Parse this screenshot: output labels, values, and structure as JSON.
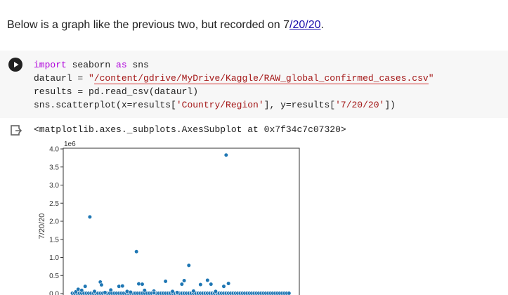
{
  "markdown": {
    "prefix": "Below is a graph like the previous two, but recorded on 7",
    "link": "/20/20",
    "suffix": "."
  },
  "code": {
    "line1": {
      "kw1": "import",
      "mod": " seaborn ",
      "kw2": "as",
      "alias": " sns"
    },
    "line2": {
      "lhs": "dataurl = ",
      "q1": "\"",
      "path": "/content/gdrive/MyDrive/Kaggle/RAW_global_confirmed_cases.csv",
      "q2": "\""
    },
    "line3": "results = pd.read_csv(dataurl)",
    "line4": {
      "a": "sns.scatterplot(x=results[",
      "s1": "'Country/Region'",
      "b": "], y=results[",
      "s2": "'7/20/20'",
      "c": "])"
    }
  },
  "output": {
    "repr": "<matplotlib.axes._subplots.AxesSubplot at 0x7f34c7c07320>"
  },
  "chart_data": {
    "type": "scatter",
    "ylabel": "7/20/20",
    "xlabel": "",
    "y_multiplier": "1e6",
    "ylim": [
      0,
      4.0
    ],
    "yticks": [
      "0.0",
      "0.5",
      "1.0",
      "1.5",
      "2.0",
      "2.5",
      "3.0",
      "3.5",
      "4.0"
    ],
    "grid": false,
    "x_count": 188,
    "points": [
      [
        3,
        0.05
      ],
      [
        5,
        0.12
      ],
      [
        8,
        0.09
      ],
      [
        11,
        0.2
      ],
      [
        15,
        2.12
      ],
      [
        19,
        0.06
      ],
      [
        24,
        0.32
      ],
      [
        25,
        0.24
      ],
      [
        28,
        0.03
      ],
      [
        33,
        0.1
      ],
      [
        40,
        0.2
      ],
      [
        43,
        0.21
      ],
      [
        47,
        0.06
      ],
      [
        55,
        1.16
      ],
      [
        57,
        0.27
      ],
      [
        60,
        0.26
      ],
      [
        62,
        0.09
      ],
      [
        70,
        0.07
      ],
      [
        80,
        0.34
      ],
      [
        86,
        0.06
      ],
      [
        94,
        0.26
      ],
      [
        96,
        0.36
      ],
      [
        100,
        0.78
      ],
      [
        104,
        0.07
      ],
      [
        110,
        0.25
      ],
      [
        116,
        0.37
      ],
      [
        119,
        0.26
      ],
      [
        123,
        0.06
      ],
      [
        130,
        0.2
      ],
      [
        134,
        0.28
      ],
      [
        132,
        3.83
      ],
      [
        70,
        0.02
      ],
      [
        50,
        0.04
      ],
      [
        90,
        0.03
      ]
    ],
    "series_color": "#1f77b4"
  },
  "colors": {
    "accent": "#1f77b4",
    "cell_bg": "#f7f7f7",
    "keyword": "#af00db",
    "string": "#a31515"
  }
}
